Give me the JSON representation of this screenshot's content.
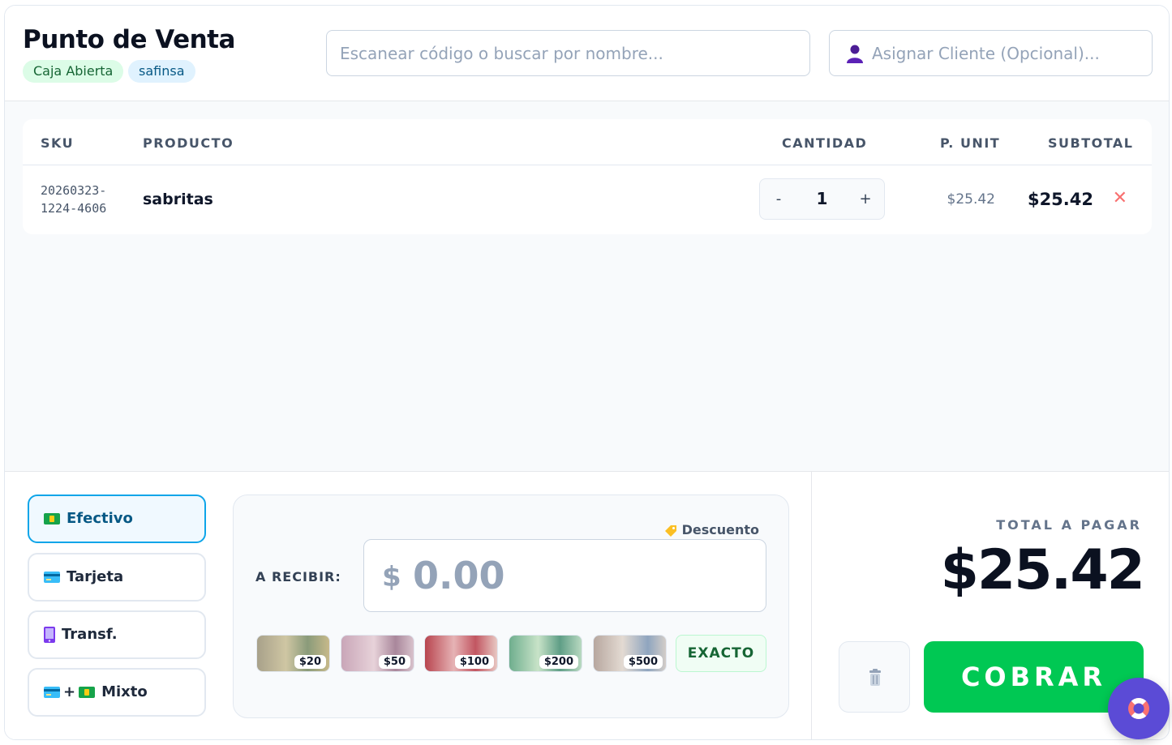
{
  "header": {
    "title": "Punto de Venta",
    "status_badge": "Caja Abierta",
    "user_badge": "safinsa",
    "search_placeholder": "Escanear código o buscar por nombre...",
    "client_placeholder": "Asignar Cliente (Opcional)...",
    "client_icon": "user-icon"
  },
  "cart": {
    "columns": {
      "sku": "SKU",
      "product": "PRODUCTO",
      "quantity": "CANTIDAD",
      "unit_price": "P. UNIT",
      "subtotal": "SUBTOTAL"
    },
    "items": [
      {
        "sku": "20260323-1224-4606",
        "name": "sabritas",
        "quantity": "1",
        "decrement": "-",
        "increment": "+",
        "unit_price": "$25.42",
        "subtotal": "$25.42",
        "remove": "✕"
      }
    ]
  },
  "payment": {
    "methods": [
      {
        "label": "Efectivo",
        "icon": "cash-icon",
        "active": true
      },
      {
        "label": "Tarjeta",
        "icon": "card-icon",
        "active": false
      },
      {
        "label": "Transf.",
        "icon": "phone-icon",
        "active": false
      },
      {
        "label": "Mixto",
        "icon": "card-plus-cash-icon",
        "active": false
      }
    ],
    "mixto_plus": "+",
    "discount_label": "Descuento",
    "receive_label": "A RECIBIR:",
    "currency_symbol": "$",
    "amount_placeholder": "0.00",
    "bills": [
      "$20",
      "$50",
      "$100",
      "$200",
      "$500"
    ],
    "exact_label": "EXACTO"
  },
  "summary": {
    "total_label": "TOTAL A PAGAR",
    "total_value": "$25.42",
    "charge_label": "COBRAR"
  },
  "colors": {
    "accent": "#0ea5e9",
    "charge": "#00c853",
    "remove": "#f87171",
    "help_fab": "#5b4bd6"
  }
}
